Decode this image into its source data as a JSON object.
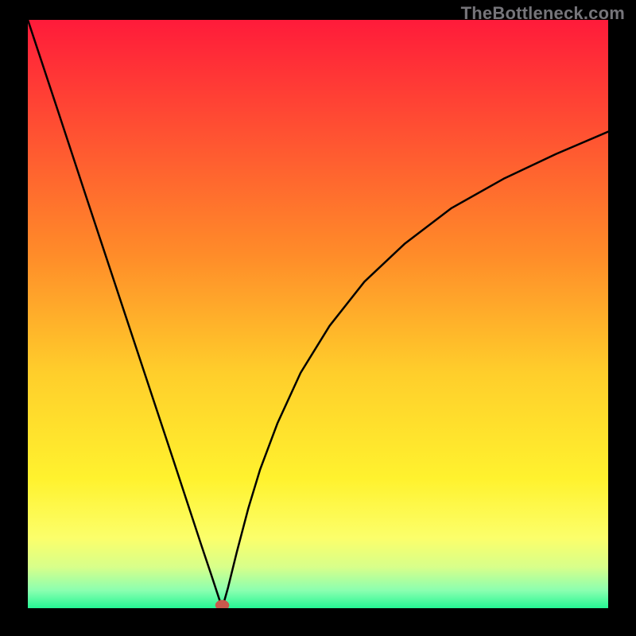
{
  "watermark": "TheBottleneck.com",
  "chart_data": {
    "type": "line",
    "title": "",
    "xlabel": "",
    "ylabel": "",
    "xlim": [
      0,
      100
    ],
    "ylim": [
      0,
      100
    ],
    "grid": false,
    "legend": false,
    "gradient_stops": [
      {
        "offset": 0,
        "color": "#ff1b3a"
      },
      {
        "offset": 0.4,
        "color": "#ff8c29"
      },
      {
        "offset": 0.6,
        "color": "#ffce2b"
      },
      {
        "offset": 0.78,
        "color": "#fff22e"
      },
      {
        "offset": 0.88,
        "color": "#fcff6a"
      },
      {
        "offset": 0.93,
        "color": "#d8ff8a"
      },
      {
        "offset": 0.97,
        "color": "#8affb0"
      },
      {
        "offset": 1.0,
        "color": "#25f694"
      }
    ],
    "marker": {
      "x": 33.5,
      "y": 0.5,
      "rx": 1.2,
      "ry": 0.9,
      "color": "#c9594d"
    },
    "series": [
      {
        "name": "curve",
        "color": "#000000",
        "stroke_width": 2.5,
        "x": [
          0.0,
          5,
          10,
          15,
          20,
          25,
          28,
          30,
          31.5,
          32.5,
          33.5,
          34.5,
          36,
          38,
          40,
          43,
          47,
          52,
          58,
          65,
          73,
          82,
          91,
          100
        ],
        "y": [
          100,
          85.1,
          70.1,
          55.2,
          40.3,
          25.4,
          16.4,
          10.4,
          6.0,
          3.0,
          0.0,
          3.5,
          9.5,
          17.0,
          23.5,
          31.4,
          40.0,
          48.0,
          55.5,
          62.0,
          68.0,
          73.0,
          77.2,
          81.0
        ]
      }
    ]
  }
}
